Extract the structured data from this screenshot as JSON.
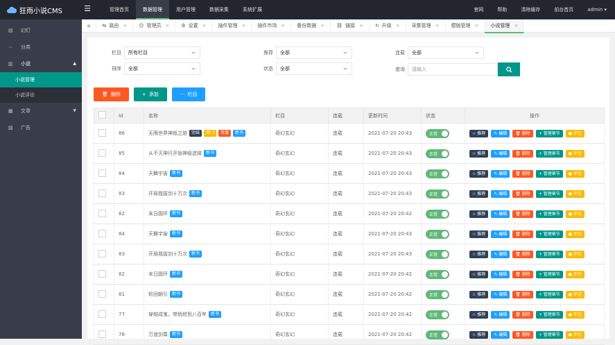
{
  "app": {
    "logo": "狂雨小说CMS"
  },
  "topnav": [
    "管理首页",
    "数据管理",
    "用户管理",
    "数据采集",
    "系统扩展"
  ],
  "topnav_active_index": 1,
  "topright": [
    "官网",
    "帮助",
    "清除缓存",
    "前台首页",
    "admin"
  ],
  "sidebar": {
    "items": [
      {
        "label": "幻灯",
        "icon": "slides-icon"
      },
      {
        "label": "分类",
        "icon": "list-icon"
      },
      {
        "label": "小说",
        "icon": "book-icon",
        "open": true,
        "sub": [
          "小说管理",
          "小说评论"
        ]
      },
      {
        "label": "文章",
        "icon": "doc-icon"
      },
      {
        "label": "广告",
        "icon": "ad-icon"
      }
    ]
  },
  "tabs": [
    "路由",
    "管理员",
    "设置",
    "插件管理",
    "插件市场",
    "备份数据",
    "链接",
    "升级",
    "采集管理",
    "模版管理",
    "小说管理"
  ],
  "filters": {
    "category_label": "栏目",
    "category_value": "所有栏目",
    "recommend_label": "推荐",
    "recommend_value": "全部",
    "serial_label": "连载",
    "serial_value": "全部",
    "sort_label": "排序",
    "sort_value": "全部",
    "status_label": "状态",
    "status_value": "全部",
    "query_label": "查询",
    "query_placeholder": "请输入"
  },
  "actions": {
    "delete": "删除",
    "add": "添加",
    "column": "栏目"
  },
  "table": {
    "headers": [
      "Id",
      "名称",
      "栏目",
      "连载",
      "更新时间",
      "状态",
      "操作"
    ],
    "status_label": "正常",
    "op_labels": [
      "推荐",
      "编辑",
      "删除",
      "管理章节",
      "评论"
    ],
    "rows": [
      {
        "id": "86",
        "name": "无限世界神祇之旅",
        "tags": [
          {
            "t": "完结",
            "c": "dark"
          },
          {
            "t": "热门",
            "c": "orange"
          },
          {
            "t": "百度",
            "c": "red"
          },
          {
            "t": "新书",
            "c": "blue"
          }
        ],
        "cat": "奇幻玄幻",
        "serial": "连载",
        "time": "2021-07-20 20:43"
      },
      {
        "id": "85",
        "name": "从不灭神尺开始神级选择",
        "tags": [
          {
            "t": "新书",
            "c": "blue"
          }
        ],
        "cat": "奇幻玄幻",
        "serial": "连载",
        "time": "2021-07-20 20:43"
      },
      {
        "id": "84",
        "name": "天舞宇宙",
        "tags": [
          {
            "t": "新书",
            "c": "blue"
          }
        ],
        "cat": "奇幻玄幻",
        "serial": "连载",
        "time": "2021-07-20 20:43"
      },
      {
        "id": "83",
        "name": "开局我拔剑十万次",
        "tags": [
          {
            "t": "新书",
            "c": "blue"
          }
        ],
        "cat": "奇幻玄幻",
        "serial": "连载",
        "time": "2021-07-20 20:43"
      },
      {
        "id": "82",
        "name": "末日圆环",
        "tags": [
          {
            "t": "新书",
            "c": "blue"
          }
        ],
        "cat": "奇幻玄幻",
        "serial": "连载",
        "time": "2021-07-20 20:42"
      },
      {
        "id": "84",
        "name": "天舞宇宙",
        "tags": [
          {
            "t": "新书",
            "c": "blue"
          }
        ],
        "cat": "奇幻玄幻",
        "serial": "连载",
        "time": "2021-07-20 20:43"
      },
      {
        "id": "83",
        "name": "开局我拔剑十万次",
        "tags": [
          {
            "t": "新书",
            "c": "blue"
          }
        ],
        "cat": "奇幻玄幻",
        "serial": "连载",
        "time": "2021-07-20 20:43"
      },
      {
        "id": "82",
        "name": "末日圆环",
        "tags": [
          {
            "t": "新书",
            "c": "blue"
          }
        ],
        "cat": "奇幻玄幻",
        "serial": "连载",
        "time": "2021-07-20 20:42"
      },
      {
        "id": "81",
        "name": "轮回朝引",
        "tags": [
          {
            "t": "新书",
            "c": "blue"
          }
        ],
        "cat": "奇幻玄幻",
        "serial": "连载",
        "time": "2021-07-20 20:42"
      },
      {
        "id": "77",
        "name": "穿越成鬼，带俏挖到八百年",
        "tags": [
          {
            "t": "新书",
            "c": "blue"
          }
        ],
        "cat": "奇幻玄幻",
        "serial": "连载",
        "time": "2021-07-20 20:42"
      },
      {
        "id": "76",
        "name": "万道剑尊",
        "tags": [
          {
            "t": "新书",
            "c": "blue"
          }
        ],
        "cat": "奇幻玄幻",
        "serial": "连载",
        "time": "2021-07-20 20:42"
      }
    ]
  }
}
